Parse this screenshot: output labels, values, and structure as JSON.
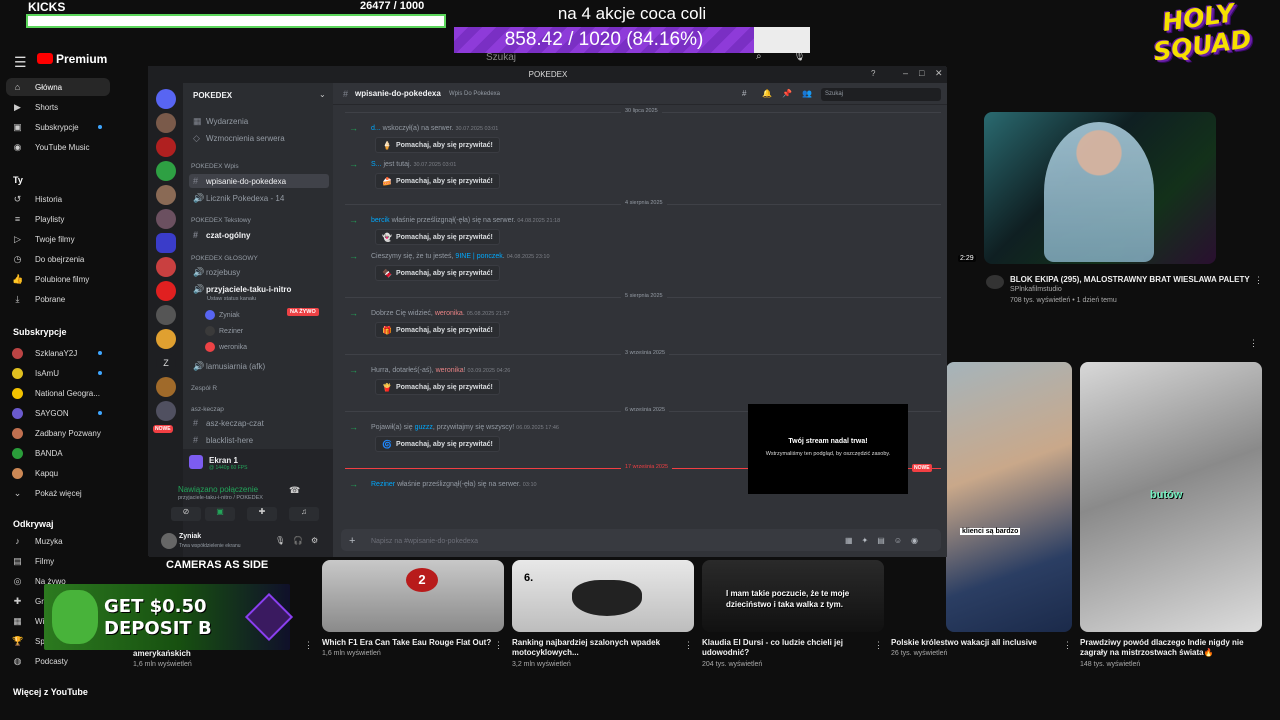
{
  "overlay": {
    "kicks_label": "KICKS",
    "kicks_count": "26477  / 1000",
    "kicks_progress": 1.0,
    "goal_title": "na 4 akcje coca coli",
    "goal_text": "858.42 / 1020 (84.16%)",
    "goal_progress": 0.8416,
    "logo_line1": "HOLY",
    "logo_line2": "SQUAD",
    "cameras_label": "CAMERAS AS SIDE",
    "ad_line1": "GET $0.50",
    "ad_line2": "DEPOSIT B"
  },
  "youtube": {
    "logo": "Premium",
    "search_placeholder": "Szukaj",
    "nav": [
      {
        "label": "Główna",
        "icon": "home-icon"
      },
      {
        "label": "Shorts",
        "icon": "shorts-icon"
      },
      {
        "label": "Subskrypcje",
        "icon": "subscriptions-icon"
      },
      {
        "label": "YouTube Music",
        "icon": "music-icon"
      }
    ],
    "you_head": "Ty",
    "you": [
      {
        "label": "Historia"
      },
      {
        "label": "Playlisty"
      },
      {
        "label": "Twoje filmy"
      },
      {
        "label": "Do obejrzenia"
      },
      {
        "label": "Polubione filmy"
      },
      {
        "label": "Pobrane"
      }
    ],
    "subs_head": "Subskrypcje",
    "subs": [
      {
        "label": "SzklanaY2J",
        "color": "#b44"
      },
      {
        "label": "IsAmU",
        "color": "#e0c020"
      },
      {
        "label": "National Geogra...",
        "color": "#f2c200"
      },
      {
        "label": "SAYGON",
        "color": "#6a5acd"
      },
      {
        "label": "Zadbany Pozwany",
        "color": "#c07050"
      },
      {
        "label": "BANDA",
        "color": "#2a9d3a"
      },
      {
        "label": "Kapqu",
        "color": "#c85"
      },
      {
        "label": "Pokaż więcej",
        "color": ""
      }
    ],
    "explore_head": "Odkrywaj",
    "explore": [
      {
        "label": "Muzyka"
      },
      {
        "label": "Filmy"
      },
      {
        "label": "Na żywo"
      },
      {
        "label": "Gry"
      },
      {
        "label": "Wiadomości"
      },
      {
        "label": "Sport"
      },
      {
        "label": "Podcasty"
      }
    ],
    "more_head": "Więcej z YouTube",
    "featured": {
      "duration": "2:29",
      "title": "BLOK EKIPA (295), MALOSTRAWNY BRAT WIESLAWA PALETY",
      "channel": "SPlnkafilmstudio",
      "meta": "708 tys. wyświetleń • 1 dzień temu"
    },
    "videos": [
      {
        "title": "amerykańskich",
        "meta": "1,6 mln wyświetleń"
      },
      {
        "title": "Which F1 Era Can Take Eau Rouge Flat Out?",
        "meta": "1,6 mln wyświetleń"
      },
      {
        "title": "Ranking najbardziej szalonych wpadek motocyklowych...",
        "meta": "3,2 mln wyświetleń"
      },
      {
        "title": "Klaudia El Dursi - co ludzie chcieli jej udowodnić?",
        "meta": "204 tys. wyświetleń"
      },
      {
        "title": "Polskie królestwo wakacji all inclusive",
        "meta": "26 tys. wyświetleń"
      },
      {
        "title": "Prawdziwy powód dlaczego Indie nigdy nie zagrały na mistrzostwach świata🔥",
        "meta": "148 tys. wyświetleń"
      }
    ],
    "captions": {
      "v3": "6.",
      "v4": "I mam takie poczucie, że te moje dzieciństwo i taka walka z tym.",
      "v5": "klienci są bardzo",
      "v6": "butów"
    }
  },
  "discord": {
    "window_title": "POKEDEX",
    "server_name": "POKEDEX",
    "top_items": [
      "Wydarzenia",
      "Wzmocnienia serwera"
    ],
    "cat_wpis": "POKEDEX Wpis",
    "ch_wpisanie": "wpisanie-do-pokedexa",
    "ch_licznik": "Licznik Pokedexa - 14",
    "cat_tekst": "POKEDEX Tekstowy",
    "ch_czat": "czat-ogólny",
    "cat_glos": "POKEDEX GŁOSOWY",
    "ch_rozjebusy": "rozjebusy",
    "ch_przyj": "przyjaciele-taku-i-nitro",
    "ch_status": "Ustaw status kanału",
    "voice_users": [
      "Zyniak",
      "Reziner",
      "weronika"
    ],
    "live": "NA ŻYWO",
    "ch_afk": "lamusiarnia (afk)",
    "cat_zespol": "Zespół R",
    "cat_asz": "asz-keczap",
    "ch_asz": "asz-keczap-czat",
    "ch_black": "blacklist-here",
    "guild_badge_new": "NOWE",
    "screen_title": "Ekran 1",
    "screen_sub": "@ 1440p 60 FPS",
    "conn_title": "Nawiązano połączenie",
    "conn_sub": "przyjaciele-taku-i-nitro / POKEDEX",
    "user_name": "Zyniak",
    "user_status": "Trwa współdzielenie ekranu",
    "chat_channel": "wpisanie-do-pokedexa",
    "chat_topic": "Wpis Do Pokedexa",
    "chat_search": "Szukaj",
    "wave_label": "Pomachaj, aby się przywitać!",
    "dates": [
      "30 lipca 2025",
      "4 sierpnia 2025",
      "5 sierpnia 2025",
      "3 września 2025",
      "6 września 2025",
      "17 września 2025"
    ],
    "messages": [
      {
        "user": "d...",
        "text": " wskoczył(a) na serwer.",
        "time": "30.07.2025 03:01",
        "sticker": "🍦"
      },
      {
        "user": "S...",
        "text": " jest tutaj.",
        "time": "30.07.2025 03:01",
        "sticker": "🍰"
      },
      {
        "user": "bercik",
        "text": " właśnie prześlizgnął(-ęła) się na serwer.",
        "time": "04.08.2025 21:18",
        "sticker": "👻"
      },
      {
        "pre": "Cieszymy się, że tu jesteś, ",
        "user": "9INE | ponczek",
        "text": ".",
        "time": "04.08.2025 23:10",
        "sticker": "🍫"
      },
      {
        "pre": "Dobrze Cię widzieć, ",
        "user": "weronika",
        "text": ".",
        "time": "05.08.2025 21:57",
        "sticker": "🎁"
      },
      {
        "pre": "Hurra, dotarłeś(-aś), ",
        "user": "weronika",
        "text": "!",
        "time": "03.09.2025 04:26",
        "sticker": "🍟"
      },
      {
        "pre": "Pojawił(a) się ",
        "user": "guzzz",
        "text": ", przywitajmy się wszyscy!",
        "time": "06.09.2025 17:46",
        "sticker": "🌀"
      },
      {
        "user": "Reziner",
        "text": " właśnie prześlizgnął(-ęła) się na serwer.",
        "time": "03:10",
        "sticker": ""
      }
    ],
    "new_label": "NOWE",
    "composer_placeholder": "Napisz na #wpisanie-do-pokedexa",
    "stream_title": "Twój stream nadal trwa!",
    "stream_sub": "Wstrzymaliśmy ten podgląd, by oszczędzić zasoby."
  }
}
